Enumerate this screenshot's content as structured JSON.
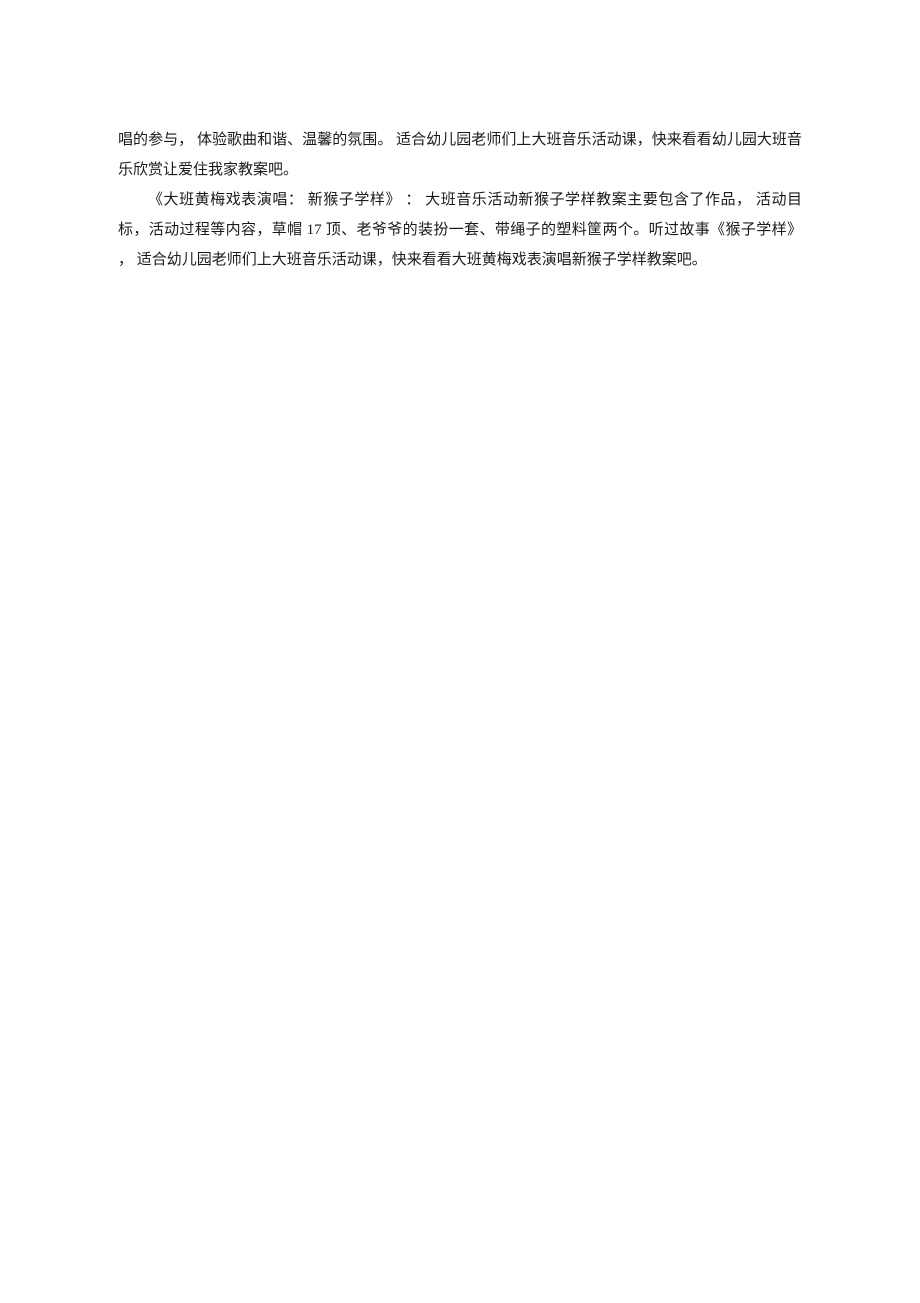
{
  "paragraphs": {
    "p1": "唱的参与， 体验歌曲和谐、温馨的氛围。 适合幼儿园老师们上大班音乐活动课，快来看看幼儿园大班音乐欣赏让爱住我家教案吧。",
    "p2": "《大班黄梅戏表演唱： 新猴子学样》 ： 大班音乐活动新猴子学样教案主要包含了作品， 活动目标，活动过程等内容，草帽 17 顶、老爷爷的装扮一套、带绳子的塑料筐两个。听过故事《猴子学样》 ， 适合幼儿园老师们上大班音乐活动课，快来看看大班黄梅戏表演唱新猴子学样教案吧。"
  }
}
